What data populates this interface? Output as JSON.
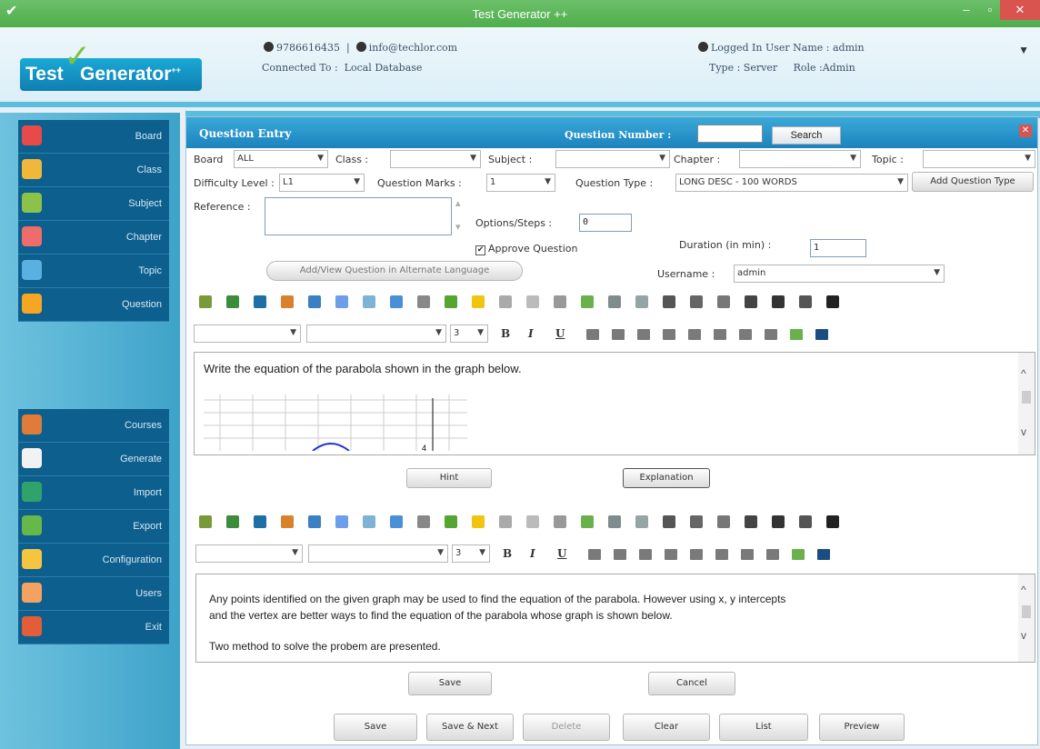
{
  "window": {
    "title": "Test Generator ++",
    "minimize": "–",
    "restore": "▫",
    "close": "✕"
  },
  "header": {
    "logo_test": "Test",
    "logo_generator": "Generator",
    "logo_sup": "++",
    "phone": "9786616435",
    "separator": "|",
    "email": "info@techlor.com",
    "connected_label": "Connected To :",
    "connected_value": "Local Database",
    "user_label": "Logged In User Name :",
    "user_value": "admin",
    "type_label": "Type :",
    "type_value": "Server",
    "role_label": "Role :",
    "role_value": "Admin"
  },
  "sidebar": {
    "top_items": [
      {
        "label": "Board",
        "color": "#e84a4a"
      },
      {
        "label": "Class",
        "color": "#f0b73a"
      },
      {
        "label": "Subject",
        "color": "#8bc34a"
      },
      {
        "label": "Chapter",
        "color": "#ef6c6c"
      },
      {
        "label": "Topic",
        "color": "#5ab0e0"
      },
      {
        "label": "Question",
        "color": "#f5a623"
      }
    ],
    "bottom_items": [
      {
        "label": "Courses",
        "color": "#e07b39"
      },
      {
        "label": "Generate",
        "color": "#f2f2f2"
      },
      {
        "label": "Import",
        "color": "#2fa36b"
      },
      {
        "label": "Export",
        "color": "#67b84a"
      },
      {
        "label": "Configuration",
        "color": "#f5c542"
      },
      {
        "label": "Users",
        "color": "#f4a261"
      },
      {
        "label": "Exit",
        "color": "#e35d3a"
      }
    ]
  },
  "panel": {
    "title": "Question Entry",
    "question_number_label": "Question Number :",
    "question_number_value": "",
    "search_button": "Search",
    "board_label": "Board",
    "board_value": "ALL",
    "class_label": "Class :",
    "class_value": "",
    "subject_label": "Subject :",
    "subject_value": "",
    "chapter_label": "Chapter :",
    "chapter_value": "",
    "topic_label": "Topic :",
    "topic_value": "",
    "difficulty_label": "Difficulty Level :",
    "difficulty_value": "L1",
    "marks_label": "Question Marks :",
    "marks_value": "1",
    "qtype_label": "Question Type :",
    "qtype_value": "LONG DESC - 100 WORDS",
    "add_qtype_button": "Add Question Type",
    "reference_label": "Reference :",
    "reference_value": "",
    "options_label": "Options/Steps :",
    "options_value": "0",
    "approve_label": "Approve Question",
    "approve_checked": true,
    "duration_label": "Duration (in min) :",
    "duration_value": "1",
    "alt_lang_button": "Add/View Question in Alternate Language",
    "username_label": "Username :",
    "username_value": "admin",
    "font_size_value": "3",
    "question_text": "Write the equation of the parabola shown in the graph below.",
    "graph_tick_label": "4",
    "hint_button": "Hint",
    "explanation_button": "Explanation",
    "explanation_line1": "Any points identified on the given graph may be used to find the equation of the parabola. However using x, y intercepts",
    "explanation_line2": "and the vertex are better ways to find the equation of the parabola whose graph is shown below.",
    "explanation_line3": "Two method to solve the probem are presented.",
    "inner_save": "Save",
    "inner_cancel": "Cancel",
    "save": "Save",
    "save_next": "Save & Next",
    "delete": "Delete",
    "clear": "Clear",
    "list": "List",
    "preview": "Preview"
  }
}
